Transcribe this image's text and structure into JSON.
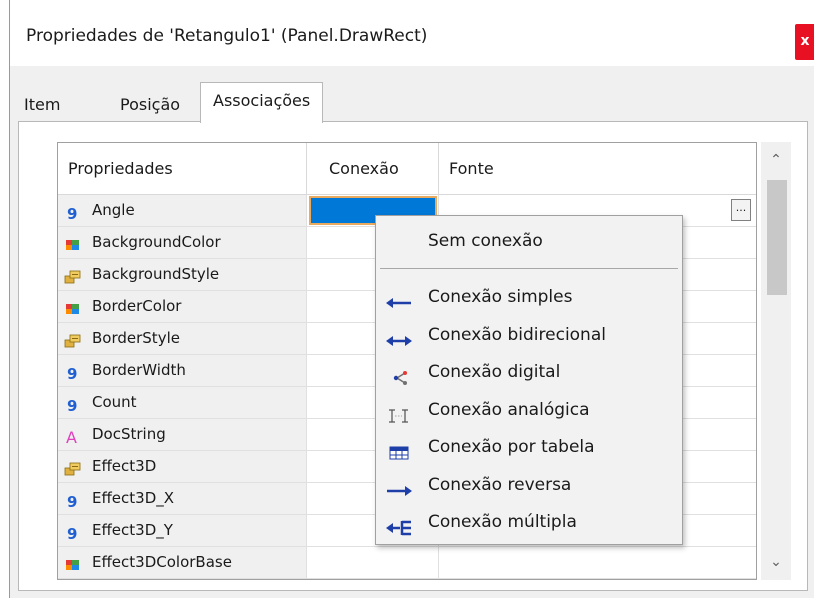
{
  "window": {
    "title": "Propriedades de 'Retangulo1' (Panel.DrawRect)",
    "close_label": "x"
  },
  "tabs": [
    {
      "label": "Item",
      "active": false
    },
    {
      "label": "Posição",
      "active": false
    },
    {
      "label": "Associações",
      "active": true
    }
  ],
  "grid": {
    "headers": {
      "properties": "Propriedades",
      "connection": "Conexão",
      "source": "Fonte"
    },
    "rows": [
      {
        "name": "Angle",
        "icon": "number-icon"
      },
      {
        "name": "BackgroundColor",
        "icon": "color-icon"
      },
      {
        "name": "BackgroundStyle",
        "icon": "enum-icon"
      },
      {
        "name": "BorderColor",
        "icon": "color-icon"
      },
      {
        "name": "BorderStyle",
        "icon": "enum-icon"
      },
      {
        "name": "BorderWidth",
        "icon": "number-icon"
      },
      {
        "name": "Count",
        "icon": "number-icon"
      },
      {
        "name": "DocString",
        "icon": "text-icon"
      },
      {
        "name": "Effect3D",
        "icon": "enum-icon"
      },
      {
        "name": "Effect3D_X",
        "icon": "number-icon"
      },
      {
        "name": "Effect3D_Y",
        "icon": "number-icon"
      },
      {
        "name": "Effect3DColorBase",
        "icon": "color-icon"
      }
    ],
    "ellipsis_label": "..."
  },
  "context_menu": {
    "items": [
      {
        "label": "Sem conexão",
        "icon": ""
      },
      {
        "label": "Conexão simples",
        "icon": "arrow-left-icon"
      },
      {
        "label": "Conexão bidirecional",
        "icon": "arrow-both-icon"
      },
      {
        "label": "Conexão digital",
        "icon": "digital-icon"
      },
      {
        "label": "Conexão analógica",
        "icon": "analog-icon"
      },
      {
        "label": "Conexão por tabela",
        "icon": "table-icon"
      },
      {
        "label": "Conexão reversa",
        "icon": "arrow-right-icon"
      },
      {
        "label": "Conexão múltipla",
        "icon": "multiple-icon"
      }
    ]
  },
  "colors": {
    "selection": "#0078d7",
    "selection_border": "#e8aa5f",
    "close": "#e81123",
    "number_icon": "#1f5fd1",
    "text_icon": "#e040c0"
  }
}
